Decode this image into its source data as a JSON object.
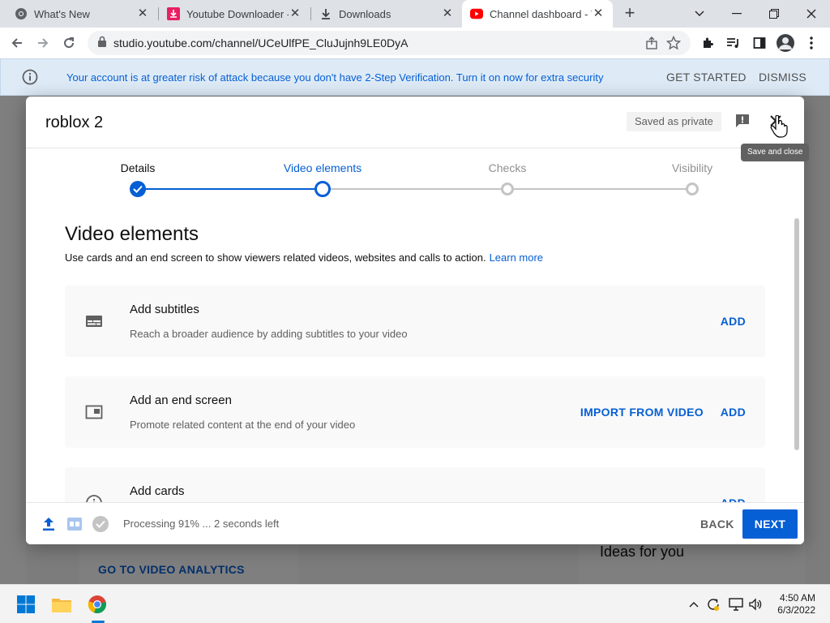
{
  "browser": {
    "tabs": [
      {
        "title": "What's New",
        "icon": "chrome-icon"
      },
      {
        "title": "Youtube Downloader - ",
        "icon": "download-app-icon"
      },
      {
        "title": "Downloads",
        "icon": "download-icon"
      },
      {
        "title": "Channel dashboard - Y",
        "icon": "youtube-icon",
        "active": true
      }
    ],
    "url": "studio.youtube.com/channel/UCeUlfPE_CluJujnh9LE0DyA"
  },
  "banner": {
    "message": "Your account is at greater risk of attack because you don't have 2-Step Verification. Turn it on now for extra security",
    "get_started": "GET STARTED",
    "dismiss": "DISMISS"
  },
  "background": {
    "analytics_link": "GO TO VIDEO ANALYTICS",
    "ideas_title": "Ideas for you"
  },
  "dialog": {
    "title": "roblox 2",
    "saved_status": "Saved as private",
    "close_tooltip": "Save and close",
    "steps": [
      {
        "label": "Details",
        "state": "done"
      },
      {
        "label": "Video elements",
        "state": "current"
      },
      {
        "label": "Checks",
        "state": "todo"
      },
      {
        "label": "Visibility",
        "state": "todo"
      }
    ],
    "section_title": "Video elements",
    "section_desc": "Use cards and an end screen to show viewers related videos, websites and calls to action.",
    "learn_more": "Learn more",
    "elements": [
      {
        "name": "Add subtitles",
        "desc": "Reach a broader audience by adding subtitles to your video",
        "action": "ADD",
        "icon": "subtitles-icon"
      },
      {
        "name": "Add an end screen",
        "desc": "Promote related content at the end of your video",
        "action": "ADD",
        "secondary_action": "IMPORT FROM VIDEO",
        "icon": "end-screen-icon"
      },
      {
        "name": "Add cards",
        "desc": "",
        "action": "ADD",
        "icon": "info-icon"
      }
    ],
    "footer": {
      "status": "Processing 91% ... 2 seconds left",
      "back": "BACK",
      "next": "NEXT"
    }
  },
  "taskbar": {
    "time": "4:50 AM",
    "date": "6/3/2022"
  },
  "colors": {
    "accent": "#065fd4",
    "banner_bg": "#deebf7",
    "step_done": "#065fd4",
    "step_todo": "#c4c4c4"
  }
}
